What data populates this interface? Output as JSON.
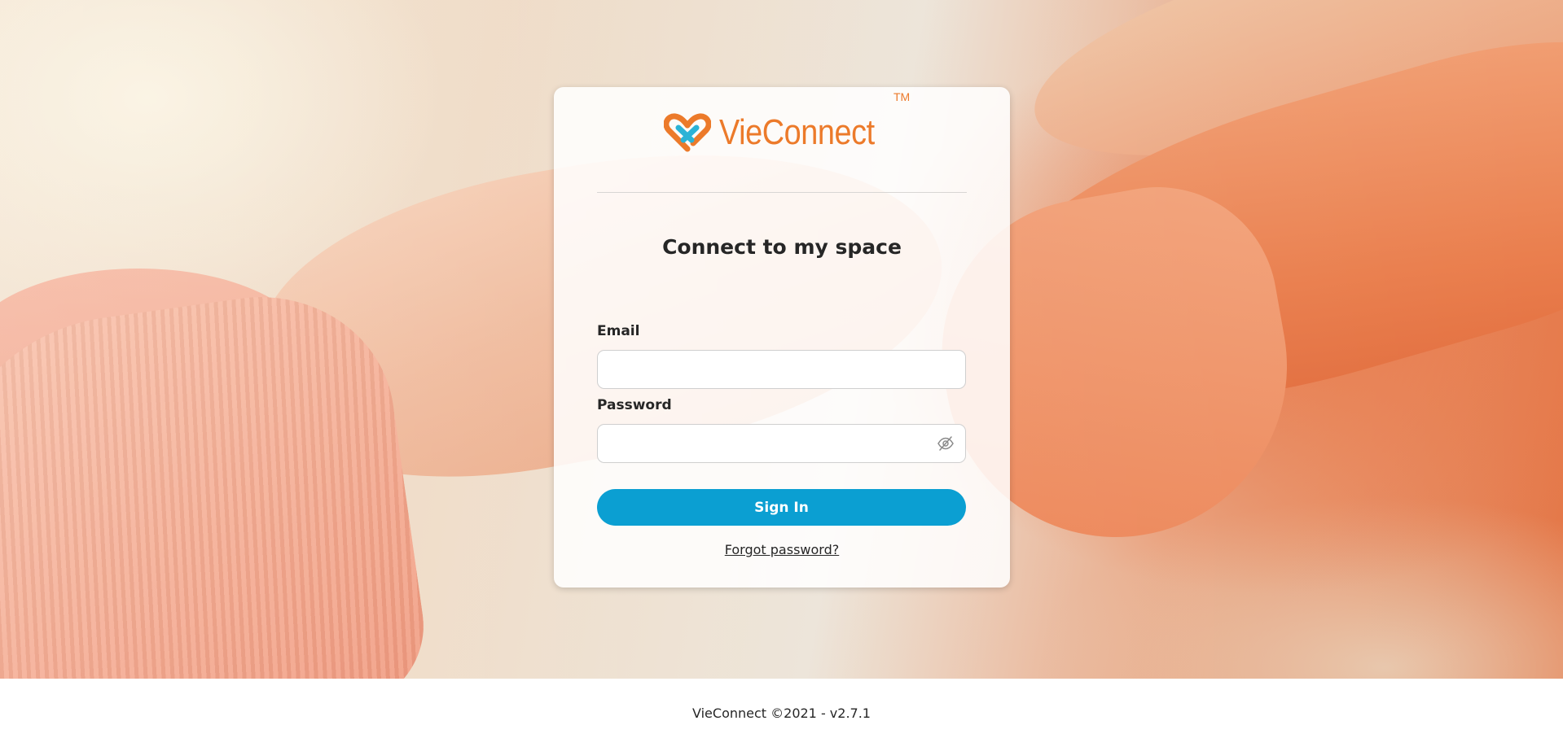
{
  "brand": {
    "name": "VieConnect",
    "trademark": "TM",
    "primary_color": "#ec7a2a",
    "secondary_color": "#2bb3d6"
  },
  "login": {
    "title": "Connect to my space",
    "email_label": "Email",
    "email_value": "",
    "password_label": "Password",
    "password_value": "",
    "password_toggle_icon": "eye-slash-icon",
    "sign_in_label": "Sign In",
    "forgot_password_label": "Forgot password?",
    "button_color": "#0b9fd2"
  },
  "footer": {
    "text": "VieConnect ©2021 - v2.7.1"
  }
}
